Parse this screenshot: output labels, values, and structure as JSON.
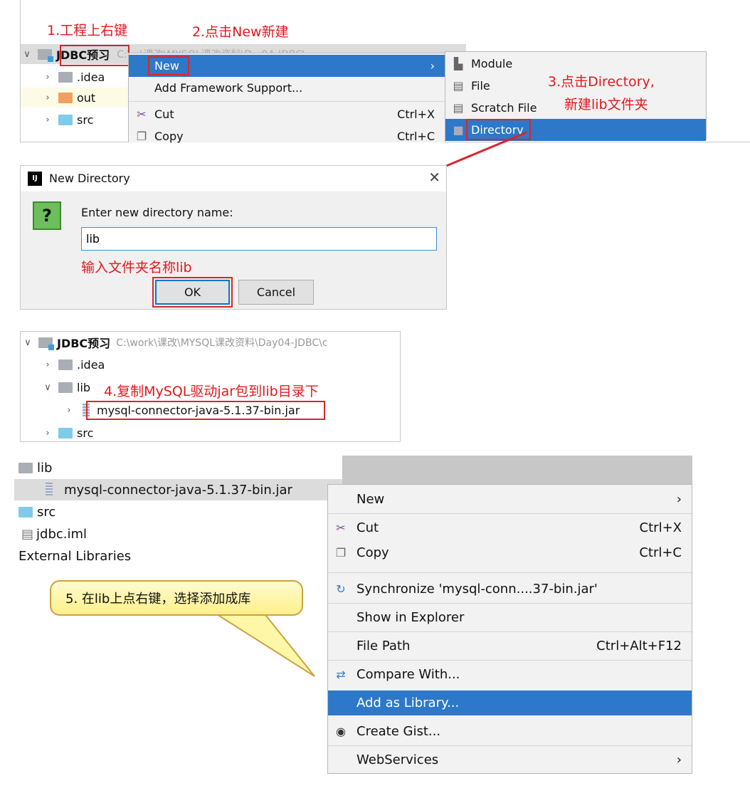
{
  "steps": {
    "s1": "1.工程上右键",
    "s2": "2.点击New新建",
    "s3a": "3.点击Directory,",
    "s3b": "新建lib文件夹",
    "s_input": "输入文件夹名称lib",
    "s4": "4.复制MySQL驱动jar包到lib目录下",
    "s5": "5. 在lib上点右键，选择添加成库"
  },
  "panel1": {
    "project": "JDBC预习",
    "path": "C:\\...\\课改\\MYSQL课改资料\\D...04-JDBC\\...",
    "tree": [
      ".idea",
      "out",
      "src"
    ],
    "menu": [
      {
        "label": "New",
        "shortcut": ""
      },
      {
        "label": "Add Framework Support...",
        "shortcut": ""
      },
      {
        "label": "Cut",
        "shortcut": "Ctrl+X"
      },
      {
        "label": "Copy",
        "shortcut": "Ctrl+C"
      }
    ],
    "submenu": [
      "Module",
      "File",
      "Scratch File",
      "Directory"
    ]
  },
  "dialog": {
    "title": "New Directory",
    "prompt": "Enter new directory name:",
    "value": "lib",
    "ok": "OK",
    "cancel": "Cancel"
  },
  "panel3": {
    "project": "JDBC预习",
    "path": "C:\\work\\课改\\MYSQL课改资料\\Day04-JDBC\\c",
    "tree": [
      ".idea",
      "lib",
      "mysql-connector-java-5.1.37-bin.jar",
      "src"
    ]
  },
  "panel4": {
    "tree": [
      "lib",
      "mysql-connector-java-5.1.37-bin.jar",
      "src",
      "jdbc.iml",
      "External Libraries"
    ],
    "menu": [
      {
        "label": "New",
        "shortcut": ""
      },
      {
        "label": "Cut",
        "shortcut": "Ctrl+X"
      },
      {
        "label": "Copy",
        "shortcut": "Ctrl+C"
      },
      {
        "label": "Synchronize 'mysql-conn....37-bin.jar'",
        "shortcut": ""
      },
      {
        "label": "Show in Explorer",
        "shortcut": ""
      },
      {
        "label": "File Path",
        "shortcut": "Ctrl+Alt+F12"
      },
      {
        "label": "Compare With...",
        "shortcut": ""
      },
      {
        "label": "Add as Library...",
        "shortcut": ""
      },
      {
        "label": "Create Gist...",
        "shortcut": ""
      },
      {
        "label": "WebServices",
        "shortcut": ""
      }
    ]
  },
  "colors": {
    "selection": "#2d78c8",
    "annotation": "#e3181e",
    "callout": "#fff7a8"
  }
}
